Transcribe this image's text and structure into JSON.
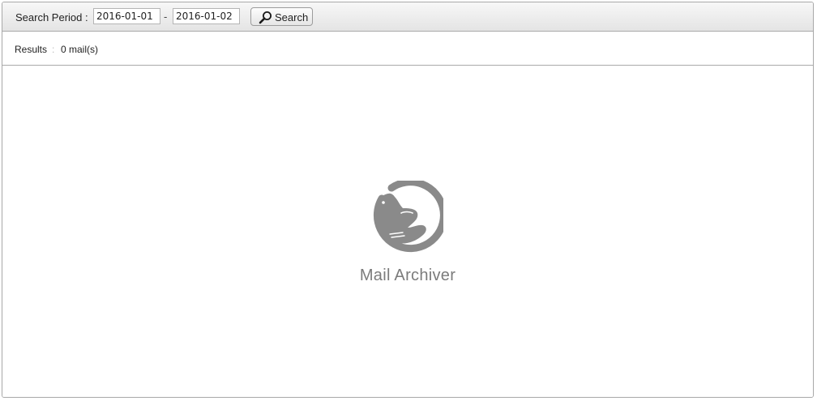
{
  "toolbar": {
    "period_label": "Search Period :",
    "date_start": "2016-01-01",
    "date_separator": "-",
    "date_end": "2016-01-02",
    "search_label": "Search",
    "search_icon": "magnifier-icon"
  },
  "results": {
    "label": "Results",
    "separator": ":",
    "count": "0 mail(s)"
  },
  "empty_state": {
    "logo_icon": "seal-logo-icon",
    "app_name": "Mail Archiver"
  },
  "colors": {
    "logo_gray": "#8a8a8a",
    "toolbar_top": "#f7f7f7",
    "toolbar_bottom": "#e4e4e4",
    "border": "#a9a9a9"
  }
}
